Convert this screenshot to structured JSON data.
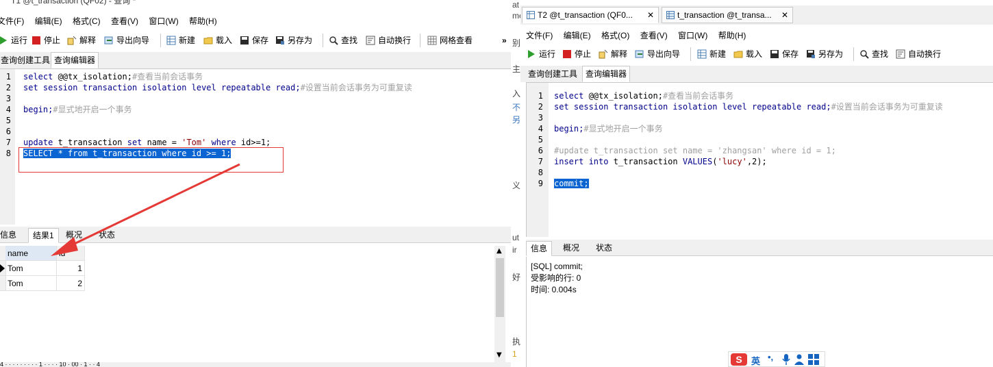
{
  "left_window": {
    "title": "T1 @t_transaction (QF02) - 查询 *",
    "menu": [
      "文件(F)",
      "编辑(E)",
      "格式(C)",
      "查看(V)",
      "窗口(W)",
      "帮助(H)"
    ],
    "toolbar": {
      "run": "运行",
      "stop": "停止",
      "explain": "解释",
      "export_wizard": "导出向导",
      "new": "新建",
      "load": "载入",
      "save": "保存",
      "save_as": "另存为",
      "find": "查找",
      "word_wrap": "自动换行",
      "grid_view": "网格查看",
      "overflow": "»"
    },
    "query_tabs": [
      "查询创建工具",
      "查询编辑器"
    ],
    "code": [
      {
        "ln": "1",
        "kw": "select ",
        "rest": "@@tx_isolation;",
        "comment": "#查看当前会话事务"
      },
      {
        "ln": "2",
        "kw": "set session transaction isolation level repeatable read;",
        "rest": "",
        "comment": "#设置当前会话事务为可重复读"
      },
      {
        "ln": "3",
        "kw": "",
        "rest": "",
        "comment": ""
      },
      {
        "ln": "4",
        "kw": "begin;",
        "rest": "",
        "comment": "#显式地开启一个事务"
      },
      {
        "ln": "5",
        "kw": "",
        "rest": "",
        "comment": ""
      },
      {
        "ln": "6",
        "kw": "",
        "rest": "",
        "comment": ""
      },
      {
        "ln": "7",
        "kw": "update",
        "rest": " t_transaction ",
        "kw2": "set",
        "rest2": " name = ",
        "str": "'Tom'",
        "kw3": " where",
        "rest3": " id>=1;"
      },
      {
        "ln": "8",
        "selected": "SELECT * from t_transaction where id >= 1;"
      }
    ],
    "result_tabs": [
      "信息",
      "结果1",
      "概况",
      "状态"
    ],
    "result_columns": [
      "name",
      "id"
    ],
    "result_rows": [
      {
        "name": "Tom",
        "id": "1"
      },
      {
        "name": "Tom",
        "id": "2"
      }
    ],
    "status_partial": "4 · · · · · · · · · 1 · · · · 10 · 00 · 1 · · 4"
  },
  "right_window": {
    "tabs": [
      {
        "label": "T2 @t_transaction (QF0...",
        "active": true
      },
      {
        "label": "t_transaction @t_transa...",
        "active": false
      }
    ],
    "menu": [
      "文件(F)",
      "编辑(E)",
      "格式(O)",
      "查看(V)",
      "窗口(W)",
      "帮助(H)"
    ],
    "toolbar": {
      "run": "运行",
      "stop": "停止",
      "explain": "解释",
      "export_wizard": "导出向导",
      "new": "新建",
      "load": "载入",
      "save": "保存",
      "save_as": "另存为",
      "find": "查找",
      "word_wrap": "自动换行"
    },
    "query_tabs": [
      "查询创建工具",
      "查询编辑器"
    ],
    "code": [
      {
        "ln": "1",
        "kw": "select ",
        "rest": "@@tx_isolation;",
        "comment": "#查看当前会话事务"
      },
      {
        "ln": "2",
        "kw": "set session transaction isolation level repeatable read;",
        "rest": "",
        "comment": "#设置当前会话事务为可重复读"
      },
      {
        "ln": "3",
        "kw": "",
        "rest": "",
        "comment": ""
      },
      {
        "ln": "4",
        "kw": "begin;",
        "rest": "",
        "comment": "#显式地开启一个事务"
      },
      {
        "ln": "5",
        "kw": "",
        "rest": "",
        "comment": ""
      },
      {
        "ln": "6",
        "kw": "",
        "rest": "",
        "comment": "#update t_transaction set name = 'zhangsan' where id = 1;"
      },
      {
        "ln": "7",
        "kw": "insert into ",
        "rest": "t_transaction ",
        "kw2": "VALUES",
        "rest2": "(",
        "str": "'lucy'",
        "rest3": ",2);"
      },
      {
        "ln": "8",
        "kw": "",
        "rest": "",
        "comment": ""
      },
      {
        "ln": "9",
        "selected": "commit;"
      }
    ],
    "result_tabs": [
      "信息",
      "概况",
      "状态"
    ],
    "message_lines": [
      "[SQL] commit;",
      "受影响的行: 0",
      "时间: 0.004s"
    ]
  },
  "middle_fragments": [
    "at",
    "me",
    "别",
    "主",
    "入",
    "不",
    "另",
    "义",
    "ut",
    "ir",
    "好",
    "执",
    "1"
  ],
  "ime": {
    "lang": "英",
    "logo": "S"
  },
  "colors": {
    "selection": "#0a64d2",
    "keyword": "#00008b",
    "comment": "#a0a0a0",
    "string": "#8b0000",
    "annotation": "#e53935"
  }
}
